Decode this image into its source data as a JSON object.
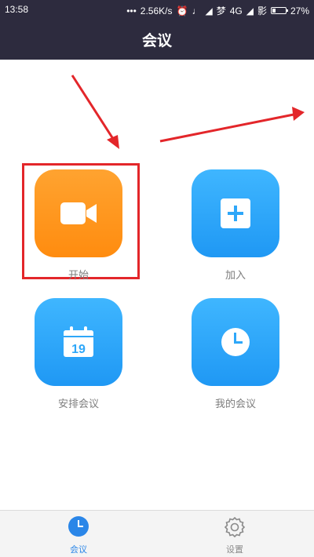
{
  "status_bar": {
    "time": "13:58",
    "network_speed": "2.56K/s",
    "network_type": "4G",
    "carrier": "梦",
    "carrier2": "影",
    "battery": "27%",
    "battery_level": 0.27
  },
  "header": {
    "title": "会议"
  },
  "tiles": [
    {
      "label": "开始",
      "icon": "video-camera-icon",
      "color": "#ff9820"
    },
    {
      "label": "加入",
      "icon": "plus-icon",
      "color": "#2ea7f9"
    },
    {
      "label": "安排会议",
      "icon": "calendar-icon",
      "calendar_day": "19",
      "color": "#2ea7f9"
    },
    {
      "label": "我的会议",
      "icon": "clock-icon",
      "color": "#2ea7f9"
    }
  ],
  "annotation": {
    "color": "#e3262a"
  },
  "bottom_nav": [
    {
      "label": "会议",
      "icon": "clock-icon",
      "active": true,
      "color": "#2a86e8"
    },
    {
      "label": "设置",
      "icon": "gear-icon",
      "active": false
    }
  ]
}
